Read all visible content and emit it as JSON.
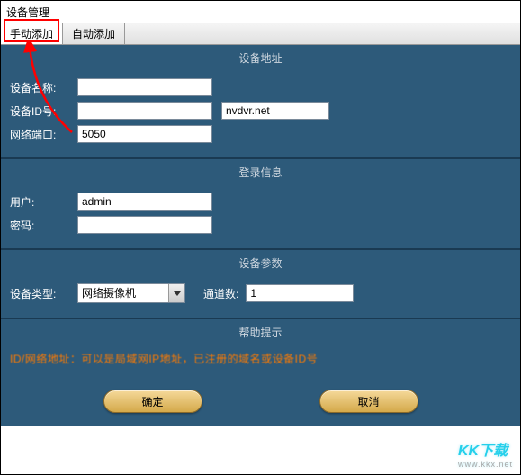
{
  "window": {
    "title": "设备管理"
  },
  "tabs": {
    "manual": "手动添加",
    "auto": "自动添加"
  },
  "sections": {
    "address": {
      "title": "设备地址",
      "device_name_label": "设备名称:",
      "device_name_value": "",
      "device_id_label": "设备ID号:",
      "device_id_value": "",
      "domain_value": "nvdvr.net",
      "port_label": "网络端口:",
      "port_value": "5050"
    },
    "login": {
      "title": "登录信息",
      "user_label": "用户:",
      "user_value": "admin",
      "password_label": "密码:",
      "password_value": ""
    },
    "params": {
      "title": "设备参数",
      "device_type_label": "设备类型:",
      "device_type_value": "网络摄像机",
      "channel_count_label": "通道数:",
      "channel_count_value": "1"
    },
    "help": {
      "title": "帮助提示",
      "text": "ID/网络地址：可以是局域网IP地址，已注册的域名或设备ID号"
    }
  },
  "buttons": {
    "ok": "确定",
    "cancel": "取消"
  },
  "watermark": {
    "main": "KK下载",
    "sub": "www.kkx.net"
  }
}
